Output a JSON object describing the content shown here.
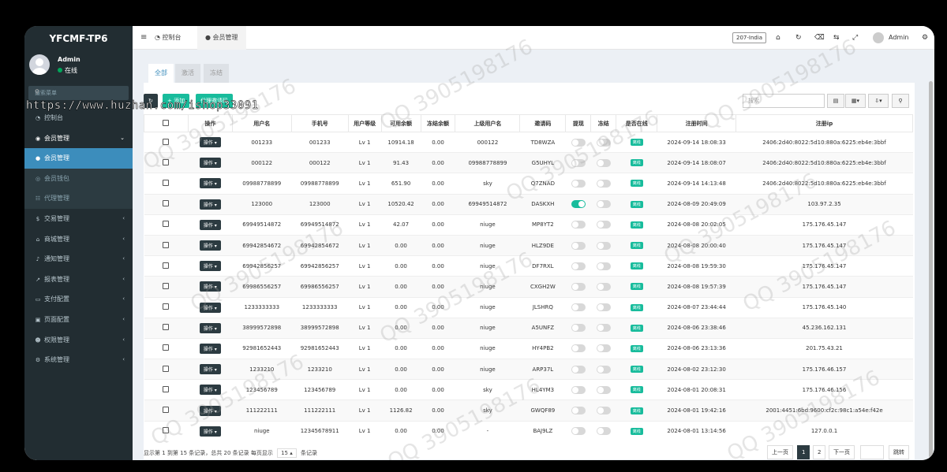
{
  "brand": {
    "title": "YFCMF-TP6"
  },
  "user": {
    "name": "Admin",
    "status": "在线"
  },
  "sidebar": {
    "search_placeholder": "搜索菜单",
    "items": [
      {
        "label": "控制台",
        "icon": "dashboard-icon"
      },
      {
        "label": "会员管理",
        "icon": "user-circle-icon"
      },
      {
        "label": "会员管理",
        "icon": "user-icon"
      },
      {
        "label": "会员钱包",
        "icon": "wallet-icon"
      },
      {
        "label": "代理管理",
        "icon": "sitemap-icon"
      },
      {
        "label": "交易管理",
        "icon": "dollar-icon"
      },
      {
        "label": "商城管理",
        "icon": "home-icon"
      },
      {
        "label": "通知管理",
        "icon": "bell-icon"
      },
      {
        "label": "报表管理",
        "icon": "chart-icon"
      },
      {
        "label": "支付配置",
        "icon": "card-icon"
      },
      {
        "label": "页面配置",
        "icon": "window-icon"
      },
      {
        "label": "权限管理",
        "icon": "users-icon"
      },
      {
        "label": "系统管理",
        "icon": "cogs-icon"
      }
    ]
  },
  "topbar": {
    "tab_dashboard": "控制台",
    "tab_member": "会员管理",
    "region": "207-India",
    "admin": "Admin"
  },
  "tabs": [
    "全部",
    "激活",
    "冻结"
  ],
  "toolbar": {
    "add_label": "添加",
    "agent_label": "代理邀请码",
    "search_placeholder": "搜索"
  },
  "table": {
    "headers": [
      "操作",
      "用户名",
      "手机号",
      "用户等级",
      "可用余额",
      "冻结余额",
      "上级用户名",
      "邀请码",
      "提现",
      "冻结",
      "是否在线",
      "注册时间",
      "注册ip"
    ],
    "op_label": "操作",
    "online_label": "离线",
    "rows": [
      {
        "username": "001233",
        "phone": "001233",
        "level": "Lv 1",
        "balance": "10914.18",
        "frozen": "0.00",
        "parent": "000122",
        "code": "TD8WZA",
        "withdraw": false,
        "time": "2024-09-14 18:08:33",
        "ip": "2406:2d40:8022:5d10:880a:6225:eb4e:3bbf"
      },
      {
        "username": "000122",
        "phone": "000122",
        "level": "Lv 1",
        "balance": "91.43",
        "frozen": "0.00",
        "parent": "09988778899",
        "code": "G5UHYL",
        "withdraw": false,
        "time": "2024-09-14 18:08:07",
        "ip": "2406:2d40:8022:5d10:880a:6225:eb4e:3bbf"
      },
      {
        "username": "09988778899",
        "phone": "09988778899",
        "level": "Lv 1",
        "balance": "651.90",
        "frozen": "0.00",
        "parent": "sky",
        "code": "Q7ZNAD",
        "withdraw": false,
        "time": "2024-09-14 14:13:48",
        "ip": "2406:2d40:8022:5d10:880a:6225:eb4e:3bbf"
      },
      {
        "username": "123000",
        "phone": "123000",
        "level": "Lv 1",
        "balance": "10520.42",
        "frozen": "0.00",
        "parent": "69949514872",
        "code": "DASKXH",
        "withdraw": true,
        "time": "2024-08-09 20:49:09",
        "ip": "103.97.2.35"
      },
      {
        "username": "69949514872",
        "phone": "69949514872",
        "level": "Lv 1",
        "balance": "42.07",
        "frozen": "0.00",
        "parent": "niuge",
        "code": "MP8YT2",
        "withdraw": false,
        "time": "2024-08-08 20:02:05",
        "ip": "175.176.45.147"
      },
      {
        "username": "69942854672",
        "phone": "69942854672",
        "level": "Lv 1",
        "balance": "0.00",
        "frozen": "0.00",
        "parent": "niuge",
        "code": "HLZ9DE",
        "withdraw": false,
        "time": "2024-08-08 20:00:40",
        "ip": "175.176.45.147"
      },
      {
        "username": "69942856257",
        "phone": "69942856257",
        "level": "Lv 1",
        "balance": "0.00",
        "frozen": "0.00",
        "parent": "niuge",
        "code": "DF7RXL",
        "withdraw": false,
        "time": "2024-08-08 19:59:30",
        "ip": "175.176.45.147"
      },
      {
        "username": "69986556257",
        "phone": "69986556257",
        "level": "Lv 1",
        "balance": "0.00",
        "frozen": "0.00",
        "parent": "niuge",
        "code": "CXGH2W",
        "withdraw": false,
        "time": "2024-08-08 19:57:39",
        "ip": "175.176.45.147"
      },
      {
        "username": "1233333333",
        "phone": "1233333333",
        "level": "Lv 1",
        "balance": "0.00",
        "frozen": "0.00",
        "parent": "niuge",
        "code": "JLSHRQ",
        "withdraw": false,
        "time": "2024-08-07 23:44:44",
        "ip": "175.176.45.140"
      },
      {
        "username": "38999572898",
        "phone": "38999572898",
        "level": "Lv 1",
        "balance": "0.00",
        "frozen": "0.00",
        "parent": "niuge",
        "code": "A5UNFZ",
        "withdraw": false,
        "time": "2024-08-06 23:38:46",
        "ip": "45.236.162.131"
      },
      {
        "username": "92981652443",
        "phone": "92981652443",
        "level": "Lv 1",
        "balance": "0.00",
        "frozen": "0.00",
        "parent": "niuge",
        "code": "HY4PB2",
        "withdraw": false,
        "time": "2024-08-06 23:13:36",
        "ip": "201.75.43.21"
      },
      {
        "username": "1233210",
        "phone": "1233210",
        "level": "Lv 1",
        "balance": "0.00",
        "frozen": "0.00",
        "parent": "niuge",
        "code": "ARP37L",
        "withdraw": false,
        "time": "2024-08-02 23:12:30",
        "ip": "175.176.46.157"
      },
      {
        "username": "123456789",
        "phone": "123456789",
        "level": "Lv 1",
        "balance": "0.00",
        "frozen": "0.00",
        "parent": "sky",
        "code": "HL4YM3",
        "withdraw": false,
        "time": "2024-08-01 20:08:31",
        "ip": "175.176.46.156"
      },
      {
        "username": "111222111",
        "phone": "111222111",
        "level": "Lv 1",
        "balance": "1126.82",
        "frozen": "0.00",
        "parent": "sky",
        "code": "GWQF89",
        "withdraw": false,
        "time": "2024-08-01 19:42:16",
        "ip": "2001:4451:6bd:9600:cf2c:98c1:a54e:f42e"
      },
      {
        "username": "niuge",
        "phone": "12345678911",
        "level": "Lv 1",
        "balance": "0.00",
        "frozen": "0.00",
        "parent": "-",
        "code": "BAJ9LZ",
        "withdraw": false,
        "time": "2024-08-01 13:14:56",
        "ip": "127.0.0.1"
      }
    ]
  },
  "footer": {
    "summary": "显示第 1 到第 15 条记录，总共 20 条记录 每页显示",
    "page_size": "15",
    "suffix": "条记录",
    "prev": "上一页",
    "page1": "1",
    "page2": "2",
    "next": "下一页",
    "jump": "跳转"
  },
  "overlay": {
    "url_text": "https://www.huzhan.com/ishop33091",
    "watermark": "QQ 3905198176"
  }
}
